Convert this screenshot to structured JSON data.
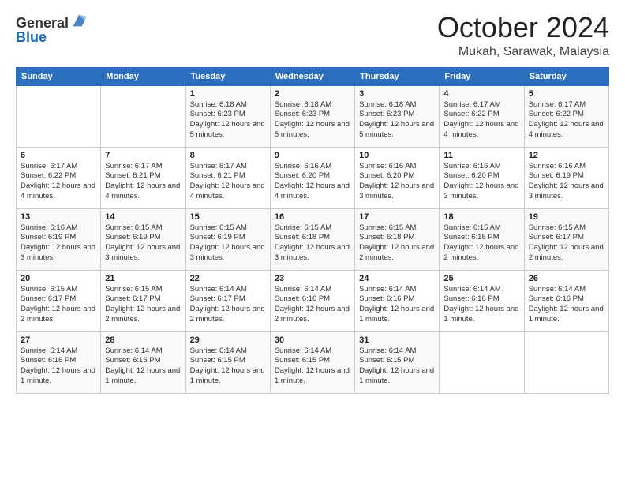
{
  "logo": {
    "general": "General",
    "blue": "Blue"
  },
  "header": {
    "month": "October 2024",
    "location": "Mukah, Sarawak, Malaysia"
  },
  "weekdays": [
    "Sunday",
    "Monday",
    "Tuesday",
    "Wednesday",
    "Thursday",
    "Friday",
    "Saturday"
  ],
  "weeks": [
    [
      {
        "day": "",
        "info": ""
      },
      {
        "day": "",
        "info": ""
      },
      {
        "day": "1",
        "info": "Sunrise: 6:18 AM\nSunset: 6:23 PM\nDaylight: 12 hours and 5 minutes."
      },
      {
        "day": "2",
        "info": "Sunrise: 6:18 AM\nSunset: 6:23 PM\nDaylight: 12 hours and 5 minutes."
      },
      {
        "day": "3",
        "info": "Sunrise: 6:18 AM\nSunset: 6:23 PM\nDaylight: 12 hours and 5 minutes."
      },
      {
        "day": "4",
        "info": "Sunrise: 6:17 AM\nSunset: 6:22 PM\nDaylight: 12 hours and 4 minutes."
      },
      {
        "day": "5",
        "info": "Sunrise: 6:17 AM\nSunset: 6:22 PM\nDaylight: 12 hours and 4 minutes."
      }
    ],
    [
      {
        "day": "6",
        "info": "Sunrise: 6:17 AM\nSunset: 6:22 PM\nDaylight: 12 hours and 4 minutes."
      },
      {
        "day": "7",
        "info": "Sunrise: 6:17 AM\nSunset: 6:21 PM\nDaylight: 12 hours and 4 minutes."
      },
      {
        "day": "8",
        "info": "Sunrise: 6:17 AM\nSunset: 6:21 PM\nDaylight: 12 hours and 4 minutes."
      },
      {
        "day": "9",
        "info": "Sunrise: 6:16 AM\nSunset: 6:20 PM\nDaylight: 12 hours and 4 minutes."
      },
      {
        "day": "10",
        "info": "Sunrise: 6:16 AM\nSunset: 6:20 PM\nDaylight: 12 hours and 3 minutes."
      },
      {
        "day": "11",
        "info": "Sunrise: 6:16 AM\nSunset: 6:20 PM\nDaylight: 12 hours and 3 minutes."
      },
      {
        "day": "12",
        "info": "Sunrise: 6:16 AM\nSunset: 6:19 PM\nDaylight: 12 hours and 3 minutes."
      }
    ],
    [
      {
        "day": "13",
        "info": "Sunrise: 6:16 AM\nSunset: 6:19 PM\nDaylight: 12 hours and 3 minutes."
      },
      {
        "day": "14",
        "info": "Sunrise: 6:15 AM\nSunset: 6:19 PM\nDaylight: 12 hours and 3 minutes."
      },
      {
        "day": "15",
        "info": "Sunrise: 6:15 AM\nSunset: 6:19 PM\nDaylight: 12 hours and 3 minutes."
      },
      {
        "day": "16",
        "info": "Sunrise: 6:15 AM\nSunset: 6:18 PM\nDaylight: 12 hours and 3 minutes."
      },
      {
        "day": "17",
        "info": "Sunrise: 6:15 AM\nSunset: 6:18 PM\nDaylight: 12 hours and 2 minutes."
      },
      {
        "day": "18",
        "info": "Sunrise: 6:15 AM\nSunset: 6:18 PM\nDaylight: 12 hours and 2 minutes."
      },
      {
        "day": "19",
        "info": "Sunrise: 6:15 AM\nSunset: 6:17 PM\nDaylight: 12 hours and 2 minutes."
      }
    ],
    [
      {
        "day": "20",
        "info": "Sunrise: 6:15 AM\nSunset: 6:17 PM\nDaylight: 12 hours and 2 minutes."
      },
      {
        "day": "21",
        "info": "Sunrise: 6:15 AM\nSunset: 6:17 PM\nDaylight: 12 hours and 2 minutes."
      },
      {
        "day": "22",
        "info": "Sunrise: 6:14 AM\nSunset: 6:17 PM\nDaylight: 12 hours and 2 minutes."
      },
      {
        "day": "23",
        "info": "Sunrise: 6:14 AM\nSunset: 6:16 PM\nDaylight: 12 hours and 2 minutes."
      },
      {
        "day": "24",
        "info": "Sunrise: 6:14 AM\nSunset: 6:16 PM\nDaylight: 12 hours and 1 minute."
      },
      {
        "day": "25",
        "info": "Sunrise: 6:14 AM\nSunset: 6:16 PM\nDaylight: 12 hours and 1 minute."
      },
      {
        "day": "26",
        "info": "Sunrise: 6:14 AM\nSunset: 6:16 PM\nDaylight: 12 hours and 1 minute."
      }
    ],
    [
      {
        "day": "27",
        "info": "Sunrise: 6:14 AM\nSunset: 6:16 PM\nDaylight: 12 hours and 1 minute."
      },
      {
        "day": "28",
        "info": "Sunrise: 6:14 AM\nSunset: 6:16 PM\nDaylight: 12 hours and 1 minute."
      },
      {
        "day": "29",
        "info": "Sunrise: 6:14 AM\nSunset: 6:15 PM\nDaylight: 12 hours and 1 minute."
      },
      {
        "day": "30",
        "info": "Sunrise: 6:14 AM\nSunset: 6:15 PM\nDaylight: 12 hours and 1 minute."
      },
      {
        "day": "31",
        "info": "Sunrise: 6:14 AM\nSunset: 6:15 PM\nDaylight: 12 hours and 1 minute."
      },
      {
        "day": "",
        "info": ""
      },
      {
        "day": "",
        "info": ""
      }
    ]
  ]
}
